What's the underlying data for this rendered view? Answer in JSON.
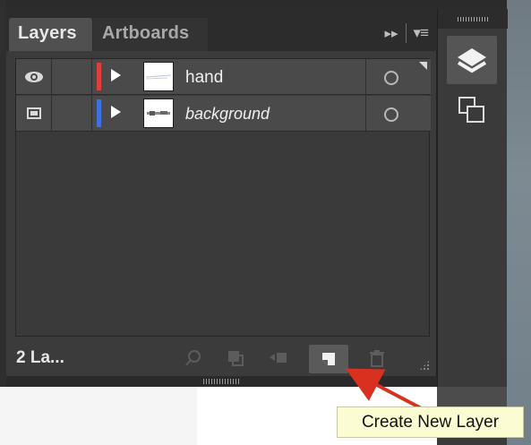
{
  "panel": {
    "tabs": [
      {
        "label": "Layers",
        "active": true
      },
      {
        "label": "Artboards",
        "active": false
      }
    ],
    "controls": {
      "collapse_icon": "double-chevron-right-icon",
      "menu_icon": "panel-menu-icon",
      "collapse_glyph": "▸▸",
      "menu_glyph": "▾≡"
    },
    "layers": [
      {
        "name": "hand",
        "visible": true,
        "color": "#e0403c",
        "selected": false,
        "visibility_icon": "eye-icon"
      },
      {
        "name": "background",
        "visible": true,
        "color": "#3f72e0",
        "selected": false,
        "visibility_icon": "template-icon"
      }
    ],
    "footer": {
      "count_label": "2 La...",
      "buttons": [
        {
          "name": "locate-object-icon",
          "enabled": false
        },
        {
          "name": "make-clipping-mask-icon",
          "enabled": false
        },
        {
          "name": "create-sublayer-icon",
          "enabled": false
        },
        {
          "name": "create-new-layer-icon",
          "enabled": true
        },
        {
          "name": "trash-icon",
          "enabled": false
        }
      ]
    }
  },
  "dock": {
    "buttons": [
      {
        "name": "layers-panel-icon",
        "active": true
      },
      {
        "name": "artboards-panel-icon",
        "active": false
      }
    ]
  },
  "tooltip": {
    "text": "Create New Layer"
  },
  "colors": {
    "panel_bg": "#3b3b3b",
    "row_bg": "#4a4a4a",
    "tooltip_bg": "#fcfcd2",
    "annotation_arrow": "#d8311f"
  }
}
